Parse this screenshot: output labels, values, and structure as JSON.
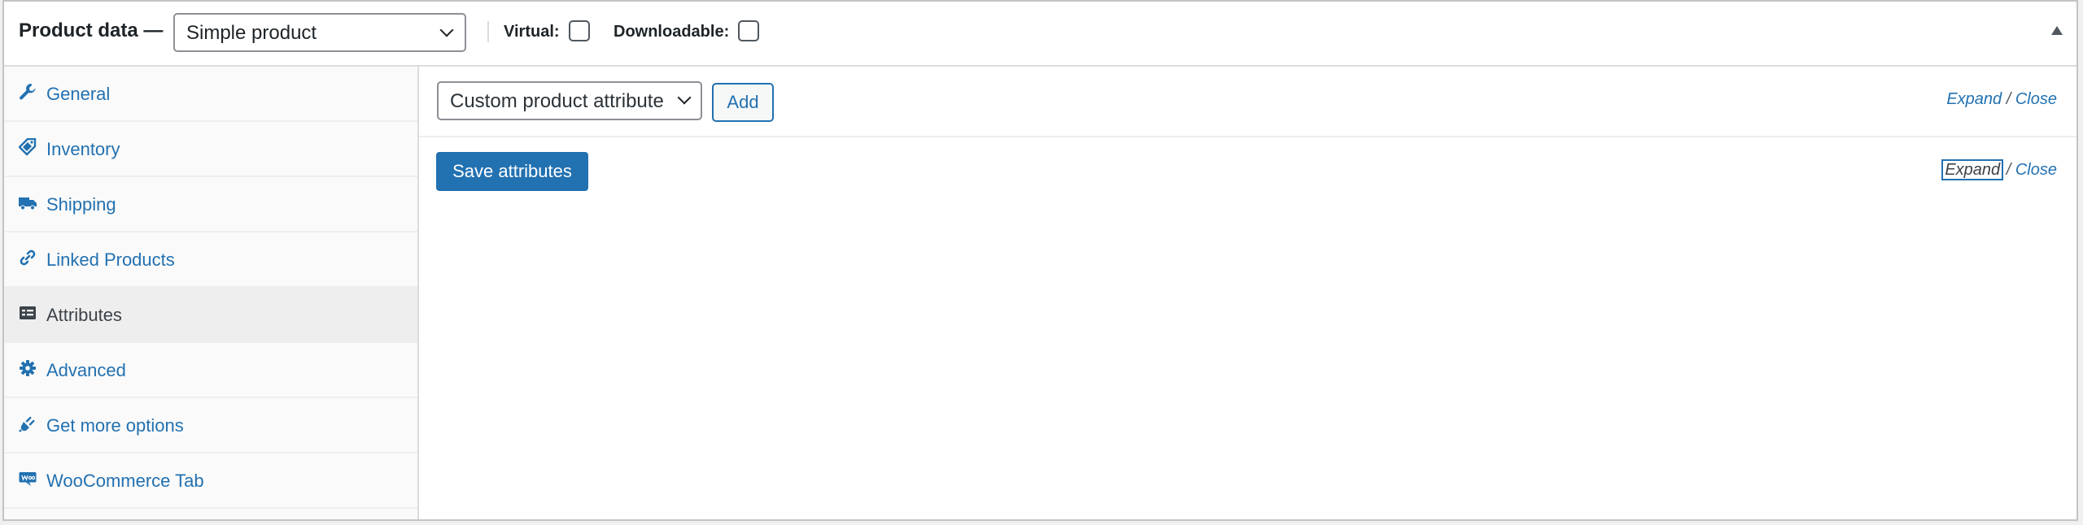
{
  "header": {
    "title": "Product data —",
    "product_type": "Simple product",
    "virtual_label": "Virtual:",
    "downloadable_label": "Downloadable:"
  },
  "sidebar": {
    "items": [
      {
        "label": "General",
        "icon": "wrench-icon"
      },
      {
        "label": "Inventory",
        "icon": "tag-icon"
      },
      {
        "label": "Shipping",
        "icon": "truck-icon"
      },
      {
        "label": "Linked Products",
        "icon": "link-icon"
      },
      {
        "label": "Attributes",
        "icon": "list-icon",
        "active": true
      },
      {
        "label": "Advanced",
        "icon": "gear-icon"
      },
      {
        "label": "Get more options",
        "icon": "plugin-icon"
      },
      {
        "label": "WooCommerce Tab",
        "icon": "woo-icon"
      }
    ]
  },
  "main": {
    "attribute_select": "Custom product attribute",
    "add_label": "Add",
    "expand_label": "Expand",
    "close_label": "Close",
    "slash": "/",
    "save_label": "Save attributes"
  },
  "colors": {
    "accent": "#2271b1",
    "active_tab_bg": "#eeeeee"
  }
}
